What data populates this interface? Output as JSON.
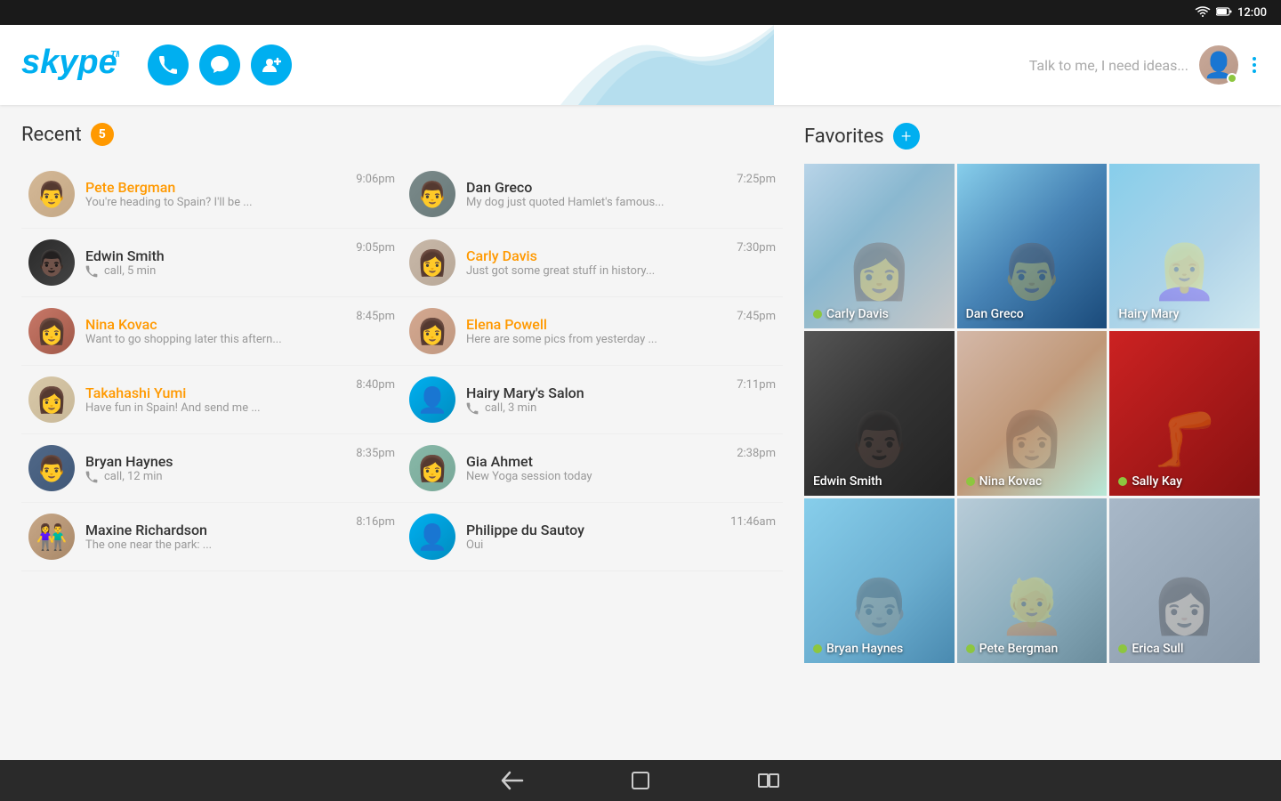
{
  "statusBar": {
    "time": "12:00",
    "wifi": "📶",
    "battery": "🔋"
  },
  "header": {
    "logo": "skype",
    "logoTm": "TM",
    "callButtonLabel": "Call",
    "chatButtonLabel": "Chat",
    "addContactLabel": "Add Contact",
    "searchPlaceholder": "Talk to me, I need ideas...",
    "moreOptions": "More options"
  },
  "recent": {
    "sectionTitle": "Recent",
    "badge": "5",
    "items": [
      {
        "name": "Pete Bergman",
        "preview": "You're heading to Spain? I'll be ...",
        "time": "9:06pm",
        "unread": true,
        "type": "message",
        "avatarBg": "av-pete",
        "emoji": "👨"
      },
      {
        "name": "Dan Greco",
        "preview": "My dog just quoted Hamlet's famous...",
        "time": "7:25pm",
        "unread": false,
        "type": "message",
        "avatarBg": "av-dan",
        "emoji": "👨"
      },
      {
        "name": "Edwin Smith",
        "preview": "call, 5 min",
        "time": "9:05pm",
        "unread": false,
        "type": "call",
        "avatarBg": "av-edwin",
        "emoji": "👨🏿"
      },
      {
        "name": "Carly Davis",
        "preview": "Just got some great stuff in history...",
        "time": "7:30pm",
        "unread": true,
        "type": "message",
        "avatarBg": "av-carly",
        "emoji": "👩"
      },
      {
        "name": "Nina Kovac",
        "preview": "Want to go shopping later this aftern...",
        "time": "8:45pm",
        "unread": true,
        "type": "message",
        "avatarBg": "av-nina",
        "emoji": "👩"
      },
      {
        "name": "Elena Powell",
        "preview": "Here are some pics from yesterday ...",
        "time": "7:45pm",
        "unread": true,
        "type": "message",
        "avatarBg": "av-elena",
        "emoji": "👩"
      },
      {
        "name": "Takahashi Yumi",
        "preview": "Have fun in Spain! And send me ...",
        "time": "8:40pm",
        "unread": true,
        "type": "message",
        "avatarBg": "av-takahashi",
        "emoji": "👩"
      },
      {
        "name": "Hairy Mary's Salon",
        "preview": "call, 3 min",
        "time": "7:11pm",
        "unread": false,
        "type": "call",
        "avatarBg": "avatar-blue",
        "emoji": "👤",
        "isGeneric": true
      },
      {
        "name": "Bryan Haynes",
        "preview": "call, 12 min",
        "time": "8:35pm",
        "unread": false,
        "type": "call",
        "avatarBg": "av-bryan",
        "emoji": "👨"
      },
      {
        "name": "Gia Ahmet",
        "preview": "New Yoga session today",
        "time": "2:38pm",
        "unread": false,
        "type": "message",
        "avatarBg": "av-gia",
        "emoji": "👩"
      },
      {
        "name": "Maxine Richardson",
        "preview": "The one near the park: ...",
        "time": "8:16pm",
        "unread": false,
        "type": "message",
        "avatarBg": "av-maxine",
        "emoji": "👫"
      },
      {
        "name": "Philippe du Sautoy",
        "preview": "Oui",
        "time": "11:46am",
        "unread": false,
        "type": "message",
        "avatarBg": "avatar-blue",
        "emoji": "👤",
        "isGeneric": true
      }
    ]
  },
  "favorites": {
    "sectionTitle": "Favorites",
    "addLabel": "+",
    "items": [
      {
        "name": "Carly Davis",
        "online": true,
        "bgClass": "fav-bg-1"
      },
      {
        "name": "Dan Greco",
        "online": false,
        "bgClass": "fav-bg-2"
      },
      {
        "name": "Hairy Mary",
        "online": false,
        "bgClass": "fav-bg-3"
      },
      {
        "name": "Edwin Smith",
        "online": false,
        "bgClass": "fav-bg-4"
      },
      {
        "name": "Nina Kovac",
        "online": true,
        "bgClass": "fav-bg-5"
      },
      {
        "name": "Sally Kay",
        "online": true,
        "bgClass": "fav-bg-6"
      },
      {
        "name": "Bryan Haynes",
        "online": true,
        "bgClass": "fav-bg-7"
      },
      {
        "name": "Pete Bergman",
        "online": true,
        "bgClass": "fav-bg-8"
      },
      {
        "name": "Erica Sull",
        "online": true,
        "bgClass": "fav-bg-9"
      }
    ]
  },
  "bottomNav": {
    "backLabel": "←",
    "homeLabel": "⬜",
    "recentLabel": "▭"
  },
  "colors": {
    "skypeBlue": "#00aff0",
    "orange": "#f90",
    "green": "#8dc63f"
  }
}
